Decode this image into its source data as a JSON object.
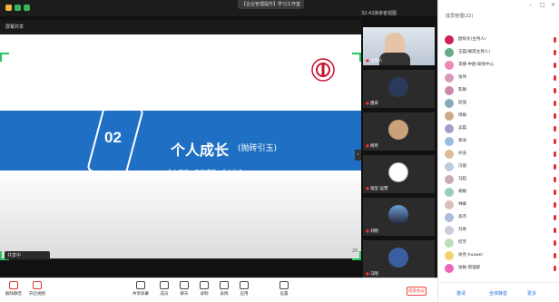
{
  "meeting": {
    "title": "【企业管理提升】学习工作室",
    "clock": "32:42",
    "view": "演讲者视图"
  },
  "share": {
    "label": "屏幕共享",
    "chip": "共享中",
    "page": "25",
    "slide": {
      "number": "02",
      "title": "个人成长",
      "subtitle": "(抛砖引玉)",
      "desc": "个人概况、工作成效、个人体会"
    }
  },
  "tiles": [
    {
      "name": "主持人",
      "bg": "#cfd8e3"
    },
    {
      "name": "唐宋",
      "bg": "#2a3a5a"
    },
    {
      "name": "杨月",
      "bg": "#333"
    },
    {
      "name": "张莹-运营",
      "bg": "#ddd"
    },
    {
      "name": "刘明",
      "bg": "#233"
    },
    {
      "name": "马晓",
      "bg": "#2c3e66"
    }
  ],
  "toolbar": [
    {
      "label": "解除静音",
      "red": true
    },
    {
      "label": "开启视频",
      "red": true
    },
    {
      "label": "共享屏幕",
      "red": false
    },
    {
      "label": "成员",
      "red": false
    },
    {
      "label": "聊天",
      "red": false
    },
    {
      "label": "录制",
      "red": false
    },
    {
      "label": "表情",
      "red": false
    },
    {
      "label": "应用",
      "red": false
    },
    {
      "label": "设置",
      "red": false
    }
  ],
  "end_label": "结束会议",
  "panel": {
    "title": "成员管理(22)",
    "participants": [
      {
        "name": "欧阳文(主持人)",
        "color": "#c25"
      },
      {
        "name": "王磊(联席主持人)",
        "color": "#6a8"
      },
      {
        "name": "李娜-中欧-研修中心",
        "color": "#e8b"
      },
      {
        "name": "张伟",
        "color": "#d9b"
      },
      {
        "name": "陈静",
        "color": "#c8a"
      },
      {
        "name": "赵强",
        "color": "#8ab"
      },
      {
        "name": "周敏",
        "color": "#ca8"
      },
      {
        "name": "吴磊",
        "color": "#a9c"
      },
      {
        "name": "郑涛",
        "color": "#9bd"
      },
      {
        "name": "孙浩",
        "color": "#db9"
      },
      {
        "name": "冯丽",
        "color": "#bcd"
      },
      {
        "name": "马超",
        "color": "#cab"
      },
      {
        "name": "胡敏",
        "color": "#9cb"
      },
      {
        "name": "林峰",
        "color": "#dbb"
      },
      {
        "name": "高杰",
        "color": "#abd"
      },
      {
        "name": "刘青",
        "color": "#ccd"
      },
      {
        "name": "何芳",
        "color": "#bdb"
      },
      {
        "name": "徐亮-huawei",
        "color": "#f2d36b"
      },
      {
        "name": "张敏-管理部",
        "color": "#e6b"
      }
    ],
    "footer": {
      "invite": "邀请",
      "mute_all": "全体静音",
      "more": "更多"
    }
  }
}
